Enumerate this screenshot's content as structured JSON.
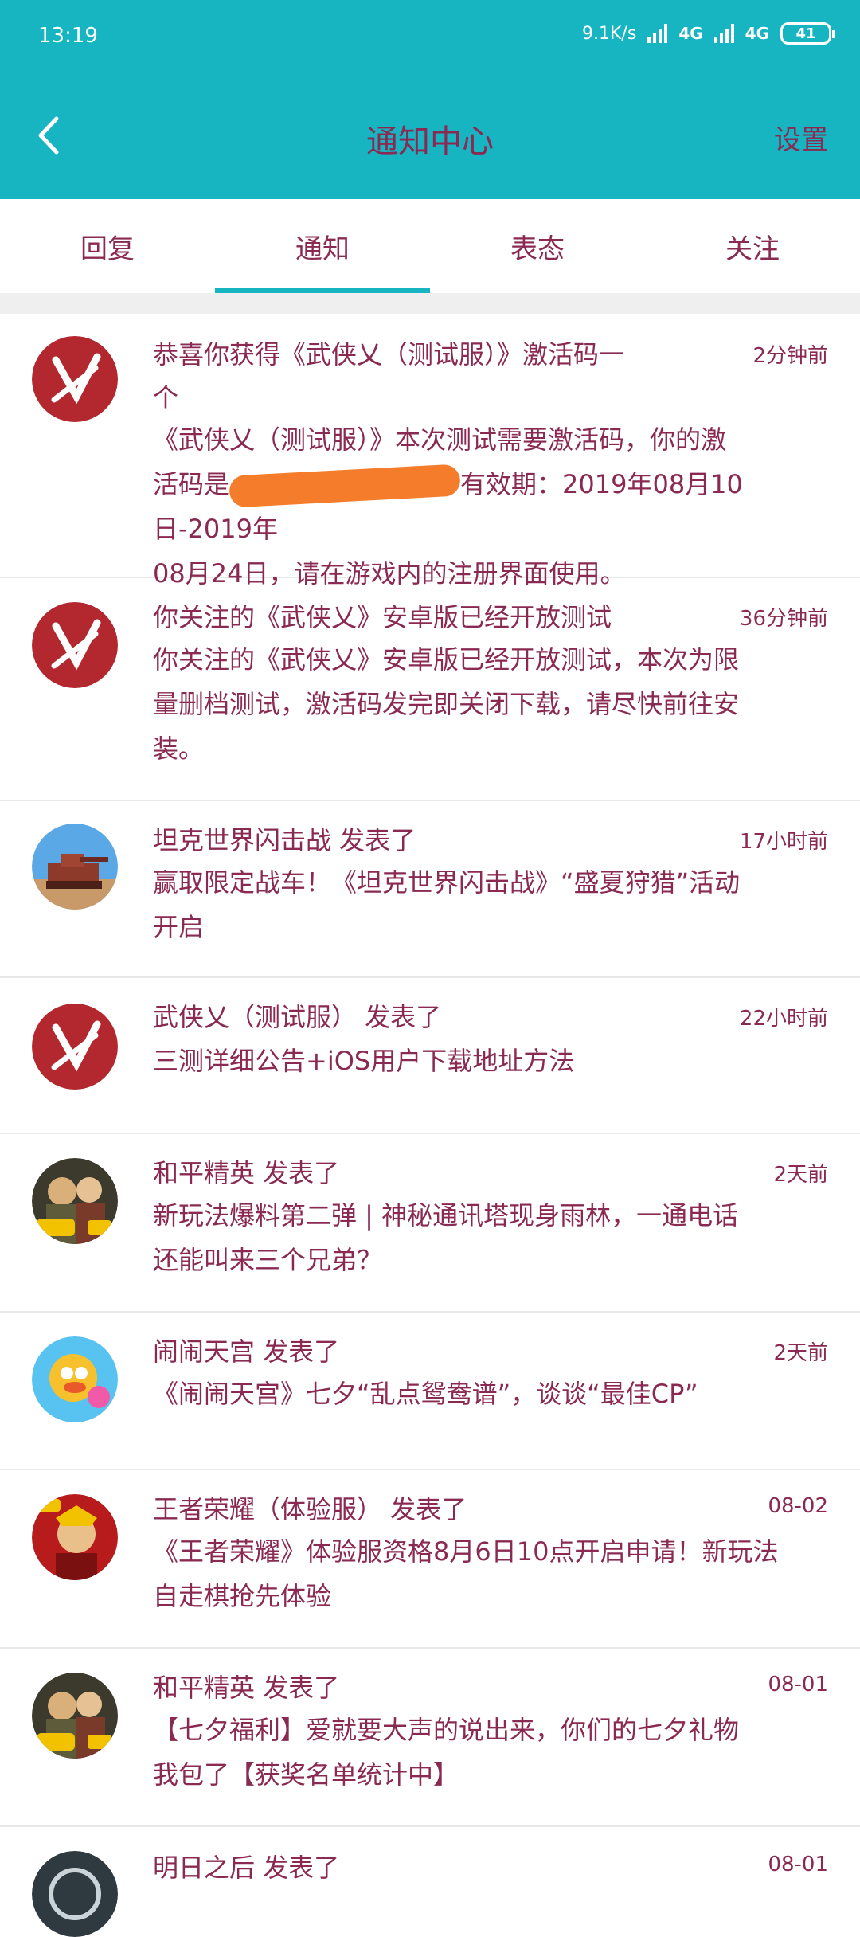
{
  "status_bar": {
    "time": "13:19",
    "net_speed": "9.1K/s",
    "network_1": "4G",
    "network_2": "4G",
    "battery": "41"
  },
  "header": {
    "title": "通知中心",
    "settings_label": "设置"
  },
  "tabs": [
    {
      "label": "回复"
    },
    {
      "label": "通知"
    },
    {
      "label": "表态"
    },
    {
      "label": "关注"
    }
  ],
  "active_tab": "通知",
  "notifications": [
    {
      "title": "恭喜你获得《武侠乂（测试服）》激活码一个",
      "title_line1": "恭喜你获得《武侠乂（测试服）》激活码一",
      "title_line2": "个",
      "time": "2分钟前",
      "body_line1": "《武侠乂（测试服）》本次测试需要激活码，你的激",
      "body_line2_prefix": "活码是",
      "body_line2_suffix": "有效期：2019年08月10日-2019年",
      "body_line3": "08月24日，请在游戏内的注册界面使用。",
      "avatar": "wuxia-logo"
    },
    {
      "title": "你关注的《武侠乂》安卓版已经开放测试",
      "time": "36分钟前",
      "body_line1": "你关注的《武侠乂》安卓版已经开放测试，本次为限",
      "body_line2": "量删档测试，激活码发完即关闭下载，请尽快前往安",
      "body_line3": "装。",
      "avatar": "wuxia-logo"
    },
    {
      "title": "坦克世界闪击战 发表了",
      "time": "17小时前",
      "body_line1": "赢取限定战车！《坦克世界闪击战》“盛夏狩猎”活动",
      "body_line2": "开启",
      "avatar": "tank-game"
    },
    {
      "title": "武侠乂（测试服） 发表了",
      "time": "22小时前",
      "body_line1": "三测详细公告+iOS用户下载地址方法",
      "avatar": "wuxia-logo"
    },
    {
      "title": "和平精英 发表了",
      "time": "2天前",
      "body_line1": "新玩法爆料第二弹 | 神秘通讯塔现身雨林，一通电话",
      "body_line2": "还能叫来三个兄弟？",
      "avatar": "peace-elite"
    },
    {
      "title": "闹闹天宫 发表了",
      "time": "2天前",
      "body_line1": "《闹闹天宫》七夕“乱点鸳鸯谱”，谈谈“最佳CP”",
      "avatar": "naonao"
    },
    {
      "title": "王者荣耀（体验服） 发表了",
      "time": "08-02",
      "body_line1": "《王者荣耀》体验服资格8月6日10点开启申请！新玩法",
      "body_line2": "自走棋抢先体验",
      "avatar": "honor-of-kings"
    },
    {
      "title": "和平精英 发表了",
      "time": "08-01",
      "body_line1": "【七夕福利】爱就要大声的说出来，你们的七夕礼物",
      "body_line2": "我包了【获奖名单统计中】",
      "avatar": "peace-elite"
    },
    {
      "title": "明日之后 发表了",
      "time": "08-01",
      "avatar": "tomorrow"
    }
  ],
  "colors": {
    "accent": "#16b5c1",
    "text": "#8a2a52",
    "redaction": "#f47c2b"
  }
}
